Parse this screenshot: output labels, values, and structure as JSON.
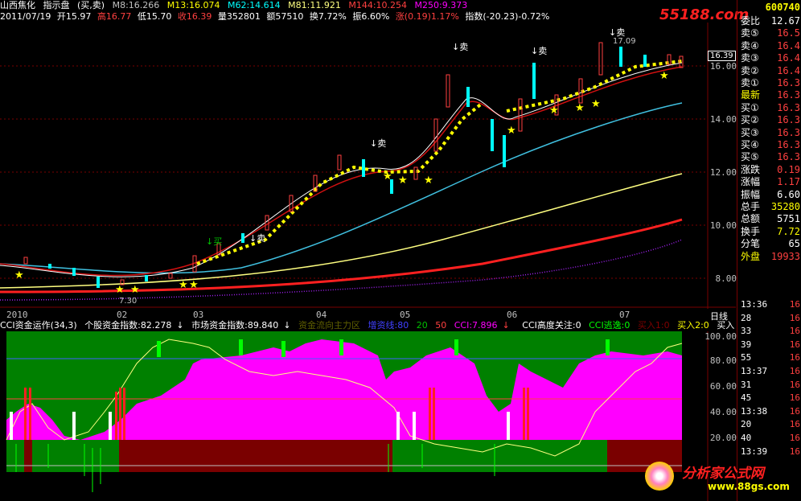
{
  "header": {
    "stock_name": "山西焦化",
    "indicator_name": "指示盘",
    "signals_label": "(买,卖)",
    "ma": [
      {
        "label": "M8:16.266",
        "color": "#ffffff"
      },
      {
        "label": "M13:16.074",
        "color": "#ffff00"
      },
      {
        "label": "M62:14.614",
        "color": "#00ffff"
      },
      {
        "label": "M81:11.921",
        "color": "#ffff80"
      },
      {
        "label": "M144:10.254",
        "color": "#ff4040"
      },
      {
        "label": "M250:9.373",
        "color": "#ff00ff"
      }
    ],
    "watermark": "55188.com"
  },
  "infobar": {
    "date": "2011/07/19",
    "open": "开15.97",
    "high": "高16.77",
    "low": "低15.70",
    "close": "收16.39",
    "volume": "量352801",
    "amount": "额57510",
    "turnover": "换7.72%",
    "amplitude": "振6.60%",
    "change": "涨(0.19)1.17%",
    "index": "指数(-20.23)-0.72%"
  },
  "price_axis": {
    "labels": [
      "16.00",
      "14.00",
      "12.00",
      "10.00",
      "8.00"
    ],
    "current_price": "16.39"
  },
  "annotations": {
    "sell": "卖",
    "buy": "买",
    "high_mark": "17.09",
    "low_mark": "7.30"
  },
  "date_axis": {
    "labels": [
      "2010",
      "02",
      "03",
      "04",
      "05",
      "06",
      "07"
    ],
    "period": "日线"
  },
  "indicator": {
    "title": "CCI资金运作(34,3)",
    "stock_fund": "个股资金指数:82.278",
    "market_fund": "市场资金指数:89.840",
    "dim_label": "资金流向主力区",
    "accum_label": "增资线:80",
    "v20": "20",
    "v50": "50",
    "cci": "CCI:7.896",
    "cci_focus": "CCI高度关注:0",
    "cci_escape": "CCI逃逸:0",
    "buy1": "买入1:0",
    "buy2": "买入2:0",
    "buy3": "买入",
    "axis": [
      "100.00",
      "80.00",
      "60.00",
      "40.00",
      "20.00"
    ]
  },
  "sidepanel": {
    "code": "600740",
    "rows": [
      {
        "label": "委比",
        "value": "12.67",
        "lc": "#ffffff",
        "vc": "#ffffff"
      },
      {
        "label": "卖⑤",
        "value": "16.5",
        "lc": "#ffffff",
        "vc": "#ff4040"
      },
      {
        "label": "卖④",
        "value": "16.4",
        "lc": "#ffffff",
        "vc": "#ff4040"
      },
      {
        "label": "卖③",
        "value": "16.4",
        "lc": "#ffffff",
        "vc": "#ff4040"
      },
      {
        "label": "卖②",
        "value": "16.4",
        "lc": "#ffffff",
        "vc": "#ff4040"
      },
      {
        "label": "卖①",
        "value": "16.3",
        "lc": "#ffffff",
        "vc": "#ff4040"
      },
      {
        "label": "最新",
        "value": "16.3",
        "lc": "#ffff00",
        "vc": "#ff4040"
      },
      {
        "label": "买①",
        "value": "16.3",
        "lc": "#ffffff",
        "vc": "#ff4040"
      },
      {
        "label": "买②",
        "value": "16.3",
        "lc": "#ffffff",
        "vc": "#ff4040"
      },
      {
        "label": "买③",
        "value": "16.3",
        "lc": "#ffffff",
        "vc": "#ff4040"
      },
      {
        "label": "买④",
        "value": "16.3",
        "lc": "#ffffff",
        "vc": "#ff4040"
      },
      {
        "label": "买⑤",
        "value": "16.3",
        "lc": "#ffffff",
        "vc": "#ff4040"
      },
      {
        "label": "涨跌",
        "value": "0.19",
        "lc": "#ffffff",
        "vc": "#ff4040"
      },
      {
        "label": "涨幅",
        "value": "1.17",
        "lc": "#ffffff",
        "vc": "#ff4040"
      },
      {
        "label": "振幅",
        "value": "6.60",
        "lc": "#ffffff",
        "vc": "#ffffff"
      },
      {
        "label": "总手",
        "value": "35280",
        "lc": "#ffffff",
        "vc": "#ffff00"
      },
      {
        "label": "总额",
        "value": "5751",
        "lc": "#ffffff",
        "vc": "#ffffff"
      },
      {
        "label": "换手",
        "value": "7.72",
        "lc": "#ffffff",
        "vc": "#ffff00"
      },
      {
        "label": "分笔",
        "value": "65",
        "lc": "#ffffff",
        "vc": "#ffffff"
      },
      {
        "label": "外盘",
        "value": "19933",
        "lc": "#ffff00",
        "vc": "#ff4040"
      }
    ],
    "ticks": [
      {
        "time": "13:36",
        "value": "16"
      },
      {
        "time": "28",
        "value": "16"
      },
      {
        "time": "33",
        "value": "16"
      },
      {
        "time": "39",
        "value": "16"
      },
      {
        "time": "55",
        "value": "16"
      },
      {
        "time": "13:37",
        "value": "16"
      },
      {
        "time": "31",
        "value": "16"
      },
      {
        "time": "45",
        "value": "16"
      },
      {
        "time": "13:38",
        "value": "16"
      },
      {
        "time": "20",
        "value": "16"
      },
      {
        "time": "40",
        "value": "16"
      },
      {
        "time": "13:39",
        "value": "16"
      }
    ]
  },
  "footer_logo": {
    "text": "分析家公式网",
    "url": "www.88gs.com"
  }
}
